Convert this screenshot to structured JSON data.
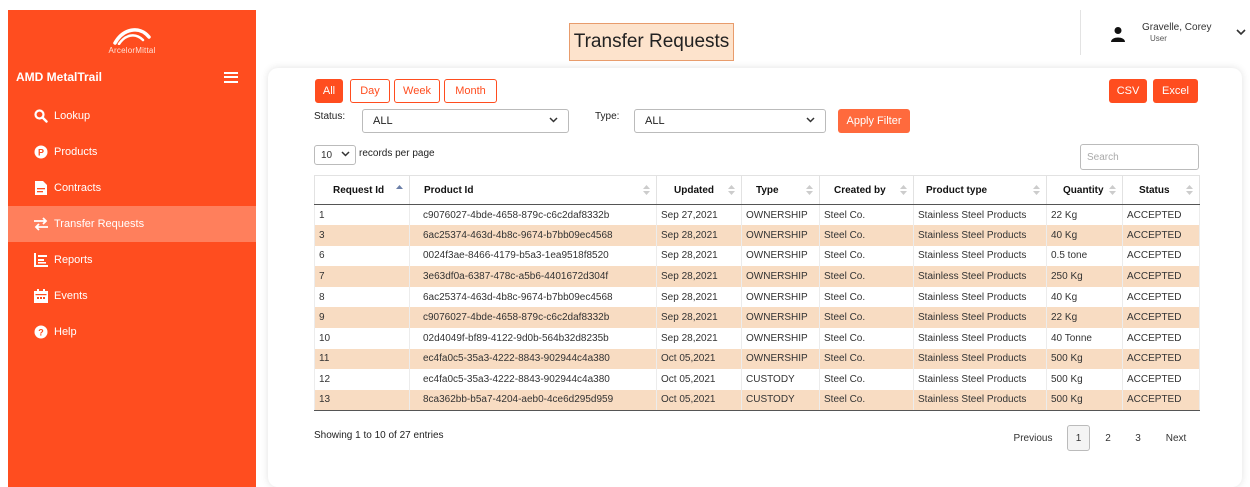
{
  "sidebar": {
    "logo_text": "ArcelorMittal",
    "brand": "AMD MetalTrail",
    "items": [
      {
        "label": "Lookup",
        "icon": "search-icon"
      },
      {
        "label": "Products",
        "icon": "products-icon"
      },
      {
        "label": "Contracts",
        "icon": "contracts-icon"
      },
      {
        "label": "Transfer Requests",
        "icon": "transfer-icon",
        "active": true
      },
      {
        "label": "Reports",
        "icon": "reports-icon"
      },
      {
        "label": "Events",
        "icon": "events-icon"
      },
      {
        "label": "Help",
        "icon": "help-icon"
      }
    ]
  },
  "header": {
    "title": "Transfer Requests",
    "user_name": "Gravelle, Corey",
    "user_role": "User"
  },
  "periods": [
    "All",
    "Day",
    "Week",
    "Month"
  ],
  "export": {
    "csv": "CSV",
    "excel": "Excel"
  },
  "filters": {
    "status_label": "Status:",
    "status_value": "ALL",
    "type_label": "Type:",
    "type_value": "ALL",
    "apply_label": "Apply Filter"
  },
  "table_controls": {
    "records_value": "10",
    "records_label": "records per page",
    "search_placeholder": "Search"
  },
  "table": {
    "columns": [
      "Request Id",
      "Product Id",
      "Updated",
      "Type",
      "Created by",
      "Product type",
      "Quantity",
      "Status"
    ],
    "rows": [
      [
        "1",
        "c9076027-4bde-4658-879c-c6c2daf8332b",
        "Sep 27,2021",
        "OWNERSHIP",
        "Steel Co.",
        "Stainless Steel Products",
        "22 Kg",
        "ACCEPTED"
      ],
      [
        "3",
        "6ac25374-463d-4b8c-9674-b7bb09ec4568",
        "Sep 28,2021",
        "OWNERSHIP",
        "Steel Co.",
        "Stainless Steel Products",
        "40 Kg",
        "ACCEPTED"
      ],
      [
        "6",
        "0024f3ae-8466-4179-b5a3-1ea9518f8520",
        "Sep 28,2021",
        "OWNERSHIP",
        "Steel Co.",
        "Stainless Steel Products",
        "0.5 tone",
        "ACCEPTED"
      ],
      [
        "7",
        "3e63df0a-6387-478c-a5b6-4401672d304f",
        "Sep 28,2021",
        "OWNERSHIP",
        "Steel Co.",
        "Stainless Steel Products",
        "250 Kg",
        "ACCEPTED"
      ],
      [
        "8",
        "6ac25374-463d-4b8c-9674-b7bb09ec4568",
        "Sep 28,2021",
        "OWNERSHIP",
        "Steel Co.",
        "Stainless Steel Products",
        "40 Kg",
        "ACCEPTED"
      ],
      [
        "9",
        "c9076027-4bde-4658-879c-c6c2daf8332b",
        "Sep 28,2021",
        "OWNERSHIP",
        "Steel Co.",
        "Stainless Steel Products",
        "22 Kg",
        "ACCEPTED"
      ],
      [
        "10",
        "02d4049f-bf89-4122-9d0b-564b32d8235b",
        "Sep 28,2021",
        "OWNERSHIP",
        "Steel Co.",
        "Stainless Steel Products",
        "40 Tonne",
        "ACCEPTED"
      ],
      [
        "11",
        "ec4fa0c5-35a3-4222-8843-902944c4a380",
        "Oct 05,2021",
        "OWNERSHIP",
        "Steel Co.",
        "Stainless Steel Products",
        "500 Kg",
        "ACCEPTED"
      ],
      [
        "12",
        "ec4fa0c5-35a3-4222-8843-902944c4a380",
        "Oct 05,2021",
        "CUSTODY",
        "Steel Co.",
        "Stainless Steel Products",
        "500 Kg",
        "ACCEPTED"
      ],
      [
        "13",
        "8ca362bb-b5a7-4204-aeb0-4ce6d295d959",
        "Oct 05,2021",
        "CUSTODY",
        "Steel Co.",
        "Stainless Steel Products",
        "500 Kg",
        "ACCEPTED"
      ]
    ]
  },
  "pagination": {
    "info": "Showing 1 to 10 of 27 entries",
    "previous": "Previous",
    "pages": [
      "1",
      "2",
      "3"
    ],
    "next": "Next"
  },
  "colors": {
    "accent": "#ff4d1f",
    "sidebar_active": "#ff7f5c",
    "row_stripe": "#f8dcc2",
    "title_bg": "#fde3cc"
  }
}
